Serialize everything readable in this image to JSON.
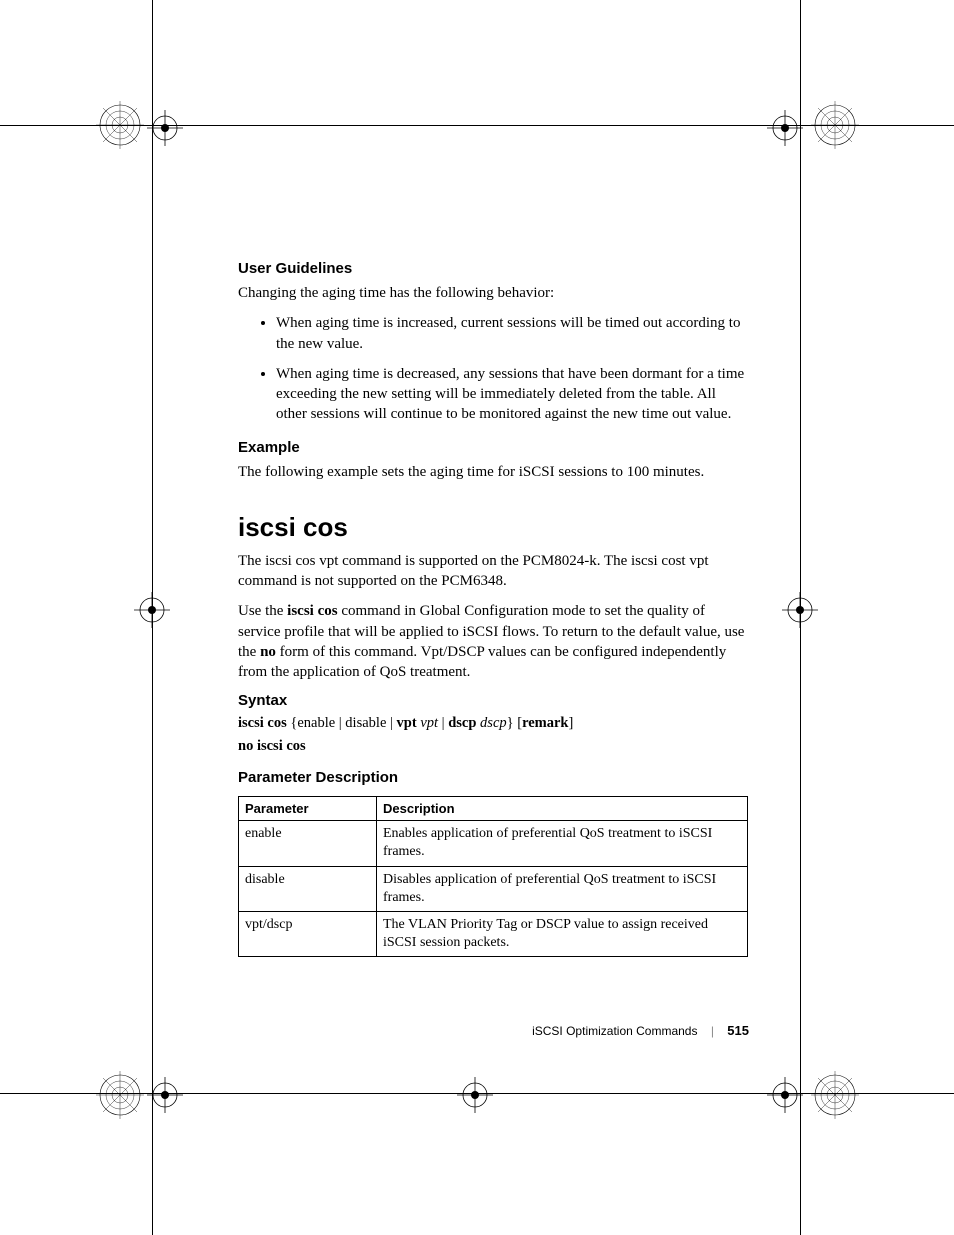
{
  "headings": {
    "user_guidelines": "User Guidelines",
    "example": "Example",
    "syntax": "Syntax",
    "param_desc": "Parameter Description"
  },
  "command_title": "iscsi cos",
  "body": {
    "ug_intro": "Changing the aging time has the following behavior:",
    "bullet1": "When aging time is increased, current sessions will be timed out according to the new value.",
    "bullet2": "When aging time is decreased, any sessions that have been dormant for a time exceeding the new setting will be immediately deleted from the table. All other sessions will continue to be monitored against the new time out value.",
    "example_text": "The following example sets the aging time for iSCSI sessions to 100 minutes.",
    "cmd_para1": "The iscsi cos vpt command is supported on the PCM8024-k. The iscsi cost vpt command is not supported on the PCM6348.",
    "cmd_para2_pre": "Use the ",
    "cmd_para2_b1": "iscsi cos",
    "cmd_para2_mid": " command in Global Configuration mode to set the quality of service profile that will be applied to iSCSI flows. To return to the default value, use the ",
    "cmd_para2_b2": "no",
    "cmd_para2_post": " form of this command. Vpt/DSCP values can be configured independently from the application of QoS treatment."
  },
  "syntax": {
    "l1_b1": "iscsi cos",
    "l1_t1": " {enable | disable | ",
    "l1_b2": "vpt",
    "l1_sp": " ",
    "l1_i1": "vpt",
    "l1_t2": " | ",
    "l1_b3": "dscp",
    "l1_i2": "dscp",
    "l1_t3": "} [",
    "l1_b4": "remark",
    "l1_t4": "]",
    "l2": "no iscsi cos"
  },
  "table": {
    "h1": "Parameter",
    "h2": "Description",
    "rows": [
      {
        "p": "enable",
        "d": "Enables application of preferential QoS treatment to iSCSI frames."
      },
      {
        "p": "disable",
        "d": "Disables application of preferential QoS treatment to iSCSI frames."
      },
      {
        "p": "vpt/dscp",
        "d": "The VLAN Priority Tag or DSCP value to assign received iSCSI session packets."
      }
    ]
  },
  "footer": {
    "section": "iSCSI Optimization Commands",
    "page": "515"
  }
}
